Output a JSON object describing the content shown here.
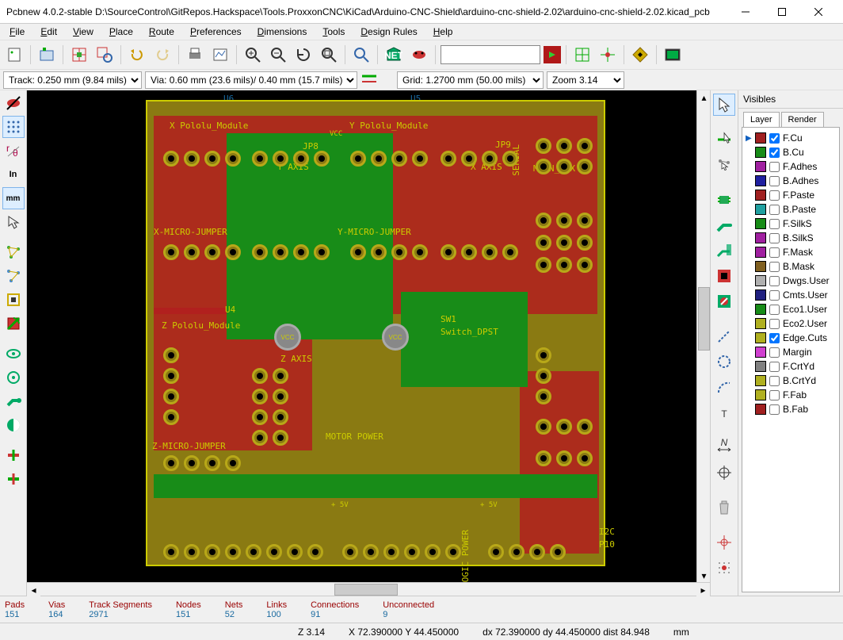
{
  "titlebar": {
    "title": "Pcbnew 4.0.2-stable D:\\SourceControl\\GitRepos.Hackspace\\Tools.ProxxonCNC\\KiCad\\Arduino-CNC-Shield\\arduino-cnc-shield-2.02\\arduino-cnc-shield-2.02.kicad_pcb"
  },
  "menus": [
    "File",
    "Edit",
    "View",
    "Place",
    "Route",
    "Preferences",
    "Dimensions",
    "Tools",
    "Design Rules",
    "Help"
  ],
  "toolbar": {
    "netsearch": ""
  },
  "toolbar2": {
    "track": "Track: 0.250 mm (9.84 mils) *",
    "via": "Via: 0.60 mm (23.6 mils)/ 0.40 mm (15.7 mils) *",
    "grid": "Grid: 1.2700 mm (50.00 mils)",
    "zoom": "Zoom 3.14"
  },
  "leftbar": {
    "unit_label": "mm",
    "inch_label": "In"
  },
  "board_labels": {
    "u6": "U6",
    "u5": "U5",
    "x_pololu": "X Pololu_Module",
    "y_pololu": "Y Pololu_Module",
    "vcc": "VCC",
    "jp8": "JP8",
    "jp9": "JP9",
    "y_axis": "Y AXIS",
    "x_axis": "X AXIS",
    "serial": "SERIAL",
    "main_aux": "MAIN_AUX",
    "x_micro": "X-MICRO-JUMPER",
    "y_micro": "Y-MICRO-JUMPER",
    "z_pololu": "Z Pololu_Module",
    "u4": "U4",
    "z_axis": "Z AXIS",
    "sw1": "SW1",
    "switch": "Switch_DPST",
    "motor_power": "MOTOR POWER",
    "z_micro": "Z-MICRO-JUMPER",
    "logic_power": "LOGIC POWER",
    "plus5v": "+ 5V",
    "i2c": "I2C",
    "p10": "P10"
  },
  "rightpanel": {
    "header": "Visibles",
    "tabs": [
      "Layer",
      "Render"
    ],
    "layers": [
      {
        "name": "F.Cu",
        "color": "#a02020",
        "checked": true,
        "active": true
      },
      {
        "name": "B.Cu",
        "color": "#188c18",
        "checked": true
      },
      {
        "name": "F.Adhes",
        "color": "#a020a0",
        "checked": false
      },
      {
        "name": "B.Adhes",
        "color": "#2020a0",
        "checked": false
      },
      {
        "name": "F.Paste",
        "color": "#a02020",
        "checked": false
      },
      {
        "name": "B.Paste",
        "color": "#20a0a0",
        "checked": false
      },
      {
        "name": "F.SilkS",
        "color": "#188c18",
        "checked": false
      },
      {
        "name": "B.SilkS",
        "color": "#a020a0",
        "checked": false
      },
      {
        "name": "F.Mask",
        "color": "#a020a0",
        "checked": false
      },
      {
        "name": "B.Mask",
        "color": "#806020",
        "checked": false
      },
      {
        "name": "Dwgs.User",
        "color": "#b0b0b0",
        "checked": false
      },
      {
        "name": "Cmts.User",
        "color": "#202080",
        "checked": false
      },
      {
        "name": "Eco1.User",
        "color": "#188c18",
        "checked": false
      },
      {
        "name": "Eco2.User",
        "color": "#b0b020",
        "checked": false
      },
      {
        "name": "Edge.Cuts",
        "color": "#b0b020",
        "checked": true
      },
      {
        "name": "Margin",
        "color": "#d040d0",
        "checked": false
      },
      {
        "name": "F.CrtYd",
        "color": "#808080",
        "checked": false
      },
      {
        "name": "B.CrtYd",
        "color": "#b0b020",
        "checked": false
      },
      {
        "name": "F.Fab",
        "color": "#b0b020",
        "checked": false
      },
      {
        "name": "B.Fab",
        "color": "#a02020",
        "checked": false
      }
    ]
  },
  "status1": {
    "cols": [
      {
        "label": "Pads",
        "value": "151"
      },
      {
        "label": "Vias",
        "value": "164"
      },
      {
        "label": "Track Segments",
        "value": "2971"
      },
      {
        "label": "Nodes",
        "value": "151"
      },
      {
        "label": "Nets",
        "value": "52"
      },
      {
        "label": "Links",
        "value": "100"
      },
      {
        "label": "Connections",
        "value": "91"
      },
      {
        "label": "Unconnected",
        "value": "9"
      }
    ]
  },
  "status2": {
    "zoom": "Z 3.14",
    "abs": "X 72.390000  Y 44.450000",
    "rel": "dx 72.390000  dy 44.450000  dist 84.948",
    "unit": "mm"
  }
}
